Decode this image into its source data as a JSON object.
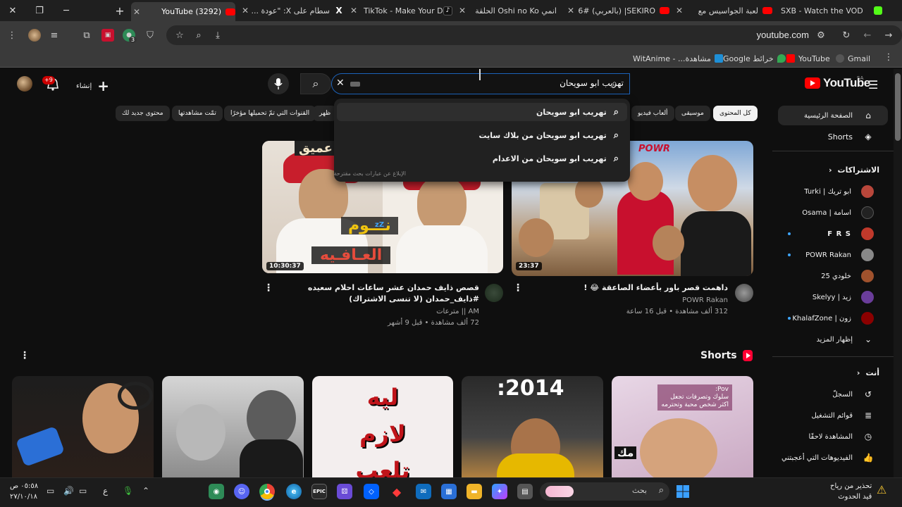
{
  "browser": {
    "tabs": [
      {
        "title": "(3292) YouTube",
        "active": true
      },
      {
        "title": "سطام على X: \"عودة ...",
        "active": false
      },
      {
        "title": "TikTok - Make Your Day",
        "active": false
      },
      {
        "title": "انمي Oshi no Ko الحلقة",
        "active": false
      },
      {
        "title": "SEKIRO| (بالعربي) #6",
        "active": false
      },
      {
        "title": "لعبة الجواسيس مع",
        "active": false
      },
      {
        "title": "SXB - Watch the VOD",
        "active": false
      }
    ],
    "url": "youtube.com",
    "extension_badge": "3",
    "bookmarks": [
      "Gmail",
      "YouTube",
      "خرائط Google",
      "مشاهدة... - WitAnime"
    ]
  },
  "youtube": {
    "logo": "YouTube",
    "region": "SA",
    "search": {
      "value": "تهريب ابو سويحان",
      "suggestions": [
        "تهريب ابو سويحان",
        "تهريب ابو سويحان من بلاك سايت",
        "تهريب ابو سويحان من الاعدام"
      ],
      "report_link": "الإبلاغ عن عبارات بحث مقترحة"
    },
    "create_label": "إنشاء",
    "notifications_badge": "+9",
    "chips": [
      "كل المحتوى",
      "موسيقى",
      "ألعاب فيديو",
      "ظهر",
      "القنوات التي تمّ تحميلها مؤخرًا",
      "تمّت مشاهدتها",
      "محتوى جديد لك"
    ],
    "sidebar": {
      "home": "الصفحة الرئيسية",
      "shorts": "Shorts",
      "subscriptions_header": "الاشتراكات",
      "subscriptions": [
        {
          "name": "ابو تريك | Turki",
          "color": "#b9473b",
          "dot": false
        },
        {
          "name": "اسامة | Osama",
          "color": "#222222",
          "dot": false
        },
        {
          "name": "F R S",
          "color": "#c0392b",
          "dot": true
        },
        {
          "name": "POWR Rakan",
          "color": "#888888",
          "dot": true
        },
        {
          "name": "خلودي 25",
          "color": "#a0522d",
          "dot": false
        },
        {
          "name": "زيد | Skelyy",
          "color": "#6a3d9a",
          "dot": false
        },
        {
          "name": "زون | KhalafZone",
          "color": "#8b0000",
          "dot": true
        }
      ],
      "show_more": "إظهار المزيد",
      "you_header": "أنت",
      "you_items": [
        "السجلّ",
        "قوائم التشغيل",
        "المشاهدة لاحقًا",
        "الفيديوهات التي أعجبتني"
      ]
    },
    "videos": [
      {
        "title": "داهمت قصر باور بأعضاء الصاعقة 😂 !",
        "channel": "POWR Rakan",
        "stats": "312 ألف مشاهدة • قبل 16 ساعة",
        "duration": "23:37",
        "thumb_text": "POWR"
      },
      {
        "title": "قصص ذايف حمدان عشر ساعات احلام سعيده #ذايف_حمدان (لا تنسى الاشتراك)",
        "channel": "AM || مترعات",
        "stats": "72 ألف مشاهدة • قبل 9 أشهر",
        "duration": "10:30:37",
        "thumb_text_top": "عميق",
        "thumb_text_mid": "نـــوم",
        "thumb_text_bottom": "العـافـيه",
        "thumb_zz": "zZ"
      }
    ],
    "shorts_title": "Shorts",
    "shorts": [
      {
        "text": "Pov:\nسلوك وتصرفات تجعل\nاكثر شخص محبة وتحترمه",
        "extra": "مك"
      },
      {
        "text": ":2014"
      },
      {
        "text": "ليه\nلازم\nتلعب"
      },
      {
        "text": ""
      },
      {
        "text": ""
      }
    ]
  },
  "taskbar": {
    "search_label": "بحث",
    "clock_time": "٠٥:٥٨ ص",
    "clock_date": "٢٧/١٠/١٨",
    "lang": "ع",
    "notif_line1": "تحذير من رياح",
    "notif_line2": "قيد الحدوث"
  }
}
